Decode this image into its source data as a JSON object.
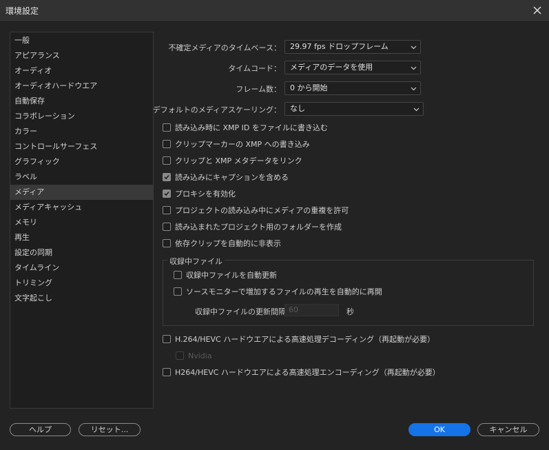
{
  "window": {
    "title": "環境設定"
  },
  "sidebar": {
    "items": [
      {
        "label": "一般"
      },
      {
        "label": "アピアランス"
      },
      {
        "label": "オーディオ"
      },
      {
        "label": "オーディオハードウエア"
      },
      {
        "label": "自動保存"
      },
      {
        "label": "コラボレーション"
      },
      {
        "label": "カラー"
      },
      {
        "label": "コントロールサーフェス"
      },
      {
        "label": "グラフィック"
      },
      {
        "label": "ラベル"
      },
      {
        "label": "メディア",
        "selected": true
      },
      {
        "label": "メディアキャッシュ"
      },
      {
        "label": "メモリ"
      },
      {
        "label": "再生"
      },
      {
        "label": "設定の同期"
      },
      {
        "label": "タイムライン"
      },
      {
        "label": "トリミング"
      },
      {
        "label": "文字起こし"
      }
    ]
  },
  "fields": {
    "timebase": {
      "label": "不確定メディアのタイムベース：",
      "value": "29.97 fps ドロップフレーム"
    },
    "timecode": {
      "label": "タイムコード：",
      "value": "メディアのデータを使用"
    },
    "frame_count": {
      "label": "フレーム数：",
      "value": "0 から開始"
    },
    "scaling": {
      "label": "デフォルトのメディアスケーリング：",
      "value": "なし"
    }
  },
  "checkboxes": {
    "xmp_write": {
      "label": "読み込み時に XMP ID をファイルに書き込む",
      "checked": false
    },
    "clip_marker_xmp": {
      "label": "クリップマーカーの XMP への書き込み",
      "checked": false
    },
    "link_xmp": {
      "label": "クリップと XMP メタデータをリンク",
      "checked": false
    },
    "import_captions": {
      "label": "読み込みにキャプションを含める",
      "checked": true
    },
    "enable_proxies": {
      "label": "プロキシを有効化",
      "checked": true
    },
    "allow_duplicates": {
      "label": "プロジェクトの読み込み中にメディアの重複を許可",
      "checked": false
    },
    "create_folders": {
      "label": "読み込まれたプロジェクト用のフォルダーを作成",
      "checked": false
    },
    "hide_dependent": {
      "label": "依存クリップを自動的に非表示",
      "checked": false
    }
  },
  "growing_files": {
    "title": "収録中ファイル",
    "auto_refresh": {
      "label": "収録中ファイルを自動更新",
      "checked": false
    },
    "source_monitor": {
      "label": "ソースモニターで増加するファイルの再生を自動的に再開",
      "checked": false
    },
    "interval_label": "収録中ファイルの更新間隔",
    "interval_value": "60",
    "interval_unit": "秒"
  },
  "hardware": {
    "decode": {
      "label": "H.264/HEVC ハードウエアによる高速処理デコーディング（再起動が必要）",
      "checked": false
    },
    "nvidia": {
      "label": "Nvidia",
      "checked": false
    },
    "encode": {
      "label": "H264/HEVC ハードウエアによる高速処理エンコーディング（再起動が必要）",
      "checked": false
    }
  },
  "buttons": {
    "help": "ヘルプ",
    "reset": "リセット...",
    "ok": "OK",
    "cancel": "キャンセル"
  },
  "colors": {
    "accent": "#1473e6",
    "background": "#232323",
    "selection": "#393939"
  }
}
